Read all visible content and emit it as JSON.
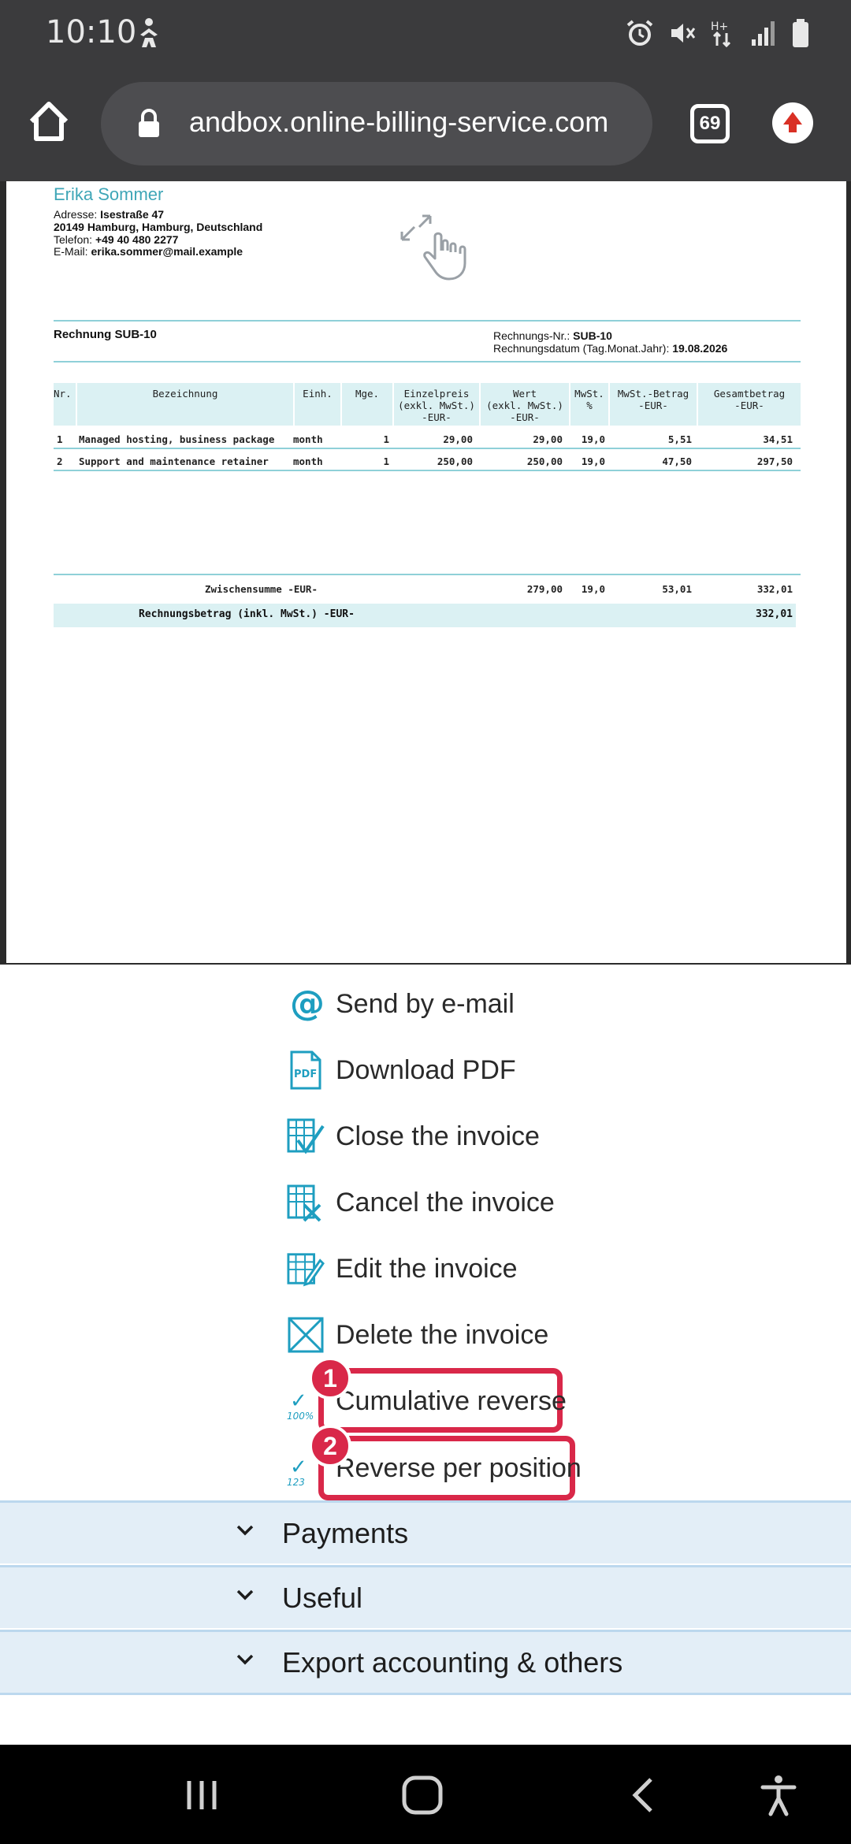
{
  "status_bar": {
    "time": "10:10"
  },
  "browser": {
    "url": "andbox.online-billing-service.com",
    "tab_count": "69"
  },
  "invoice": {
    "sender_name": "Erika Sommer",
    "address_label": "Adresse: ",
    "address_street": "Isestraße 47",
    "address_city": "20149 Hamburg, Hamburg, Deutschland",
    "phone_label": "Telefon: ",
    "phone": "+49 40 480 2277",
    "email_label": "E-Mail: ",
    "email": "erika.sommer@mail.example",
    "title": "Rechnung SUB-10",
    "number_label": "Rechnungs-Nr.: ",
    "number": "SUB-10",
    "date_label": "Rechnungsdatum (Tag.Monat.Jahr): ",
    "date": "19.08.2026",
    "columns": [
      "Nr.",
      "Bezeichnung",
      "Einh.",
      "Mge.",
      "Einzelpreis\n(exkl. MwSt.)\n-EUR-",
      "Wert\n(exkl. MwSt.)\n-EUR-",
      "MwSt.\n%",
      "MwSt.-Betrag\n-EUR-",
      "Gesamtbetrag\n-EUR-"
    ],
    "rows": [
      [
        "1",
        "Managed hosting, business package",
        "month",
        "1",
        "29,00",
        "29,00",
        "19,0",
        "5,51",
        "34,51"
      ],
      [
        "2",
        "Support and maintenance retainer",
        "month",
        "1",
        "250,00",
        "250,00",
        "19,0",
        "47,50",
        "297,50"
      ]
    ],
    "subtotal_label": "Zwischensumme -EUR-",
    "subtotal_net": "279,00",
    "subtotal_vat_rate": "19,0",
    "subtotal_vat": "53,01",
    "subtotal_total": "332,01",
    "grand_label": "Rechnungsbetrag (inkl. MwSt.) -EUR-",
    "grand_total": "332,01"
  },
  "actions": [
    {
      "label": "Send by e-mail",
      "icon": "at-icon"
    },
    {
      "label": "Download PDF",
      "icon": "pdf-icon"
    },
    {
      "label": "Close the invoice",
      "icon": "close-invoice-icon"
    },
    {
      "label": "Cancel the invoice",
      "icon": "cancel-invoice-icon"
    },
    {
      "label": "Edit the invoice",
      "icon": "edit-invoice-icon"
    },
    {
      "label": "Delete the invoice",
      "icon": "delete-invoice-icon"
    },
    {
      "label": "Cumulative reverse",
      "icon": "cumulative-reverse-icon",
      "icon_caption": "100%"
    },
    {
      "label": "Reverse per position",
      "icon": "reverse-position-icon",
      "icon_caption": "123"
    }
  ],
  "badges": [
    "1",
    "2"
  ],
  "accordions": [
    "Payments",
    "Useful",
    "Export accounting & others"
  ],
  "colors": {
    "accent": "#1e9ec0",
    "highlight": "#d92849",
    "accordion_bg": "#e3eef7",
    "table_header_bg": "#dbf1f3"
  }
}
